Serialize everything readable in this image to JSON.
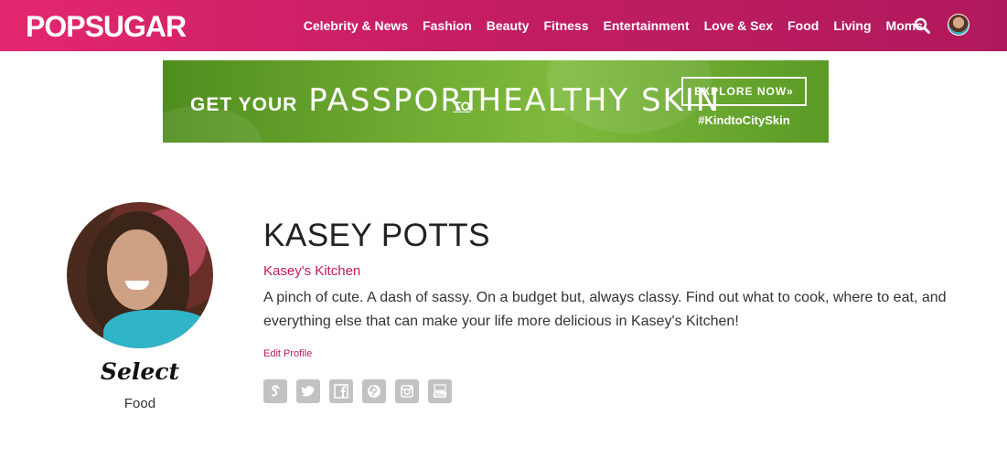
{
  "header": {
    "logo": "POPSUGAR",
    "nav": [
      "Celebrity & News",
      "Fashion",
      "Beauty",
      "Fitness",
      "Entertainment",
      "Love & Sex",
      "Food",
      "Living",
      "Moms"
    ]
  },
  "banner": {
    "small_text": "GET YOUR",
    "big_text_1": "PASSPORT",
    "to_text": "TO",
    "big_text_2": "HEALTHY SKIN",
    "cta": "EXPLORE NOW»",
    "hashtag": "#KindtoCitySkin"
  },
  "profile": {
    "badge": "Select",
    "category": "Food",
    "name": "KASEY POTTS",
    "blog_name": "Kasey's Kitchen",
    "bio": "A pinch of cute. A dash of sassy. On a budget but, always classy. Find out what to cook, where to eat, and everything else that can make your life more delicious in Kasey's Kitchen!",
    "edit_label": "Edit Profile"
  },
  "socials": [
    "sugar-icon",
    "twitter-icon",
    "facebook-icon",
    "pinterest-icon",
    "instagram-icon",
    "youtube-icon"
  ],
  "colors": {
    "brand": "#c51d63",
    "accent_link": "#c4185f",
    "social_gray": "#c2c2c2"
  }
}
